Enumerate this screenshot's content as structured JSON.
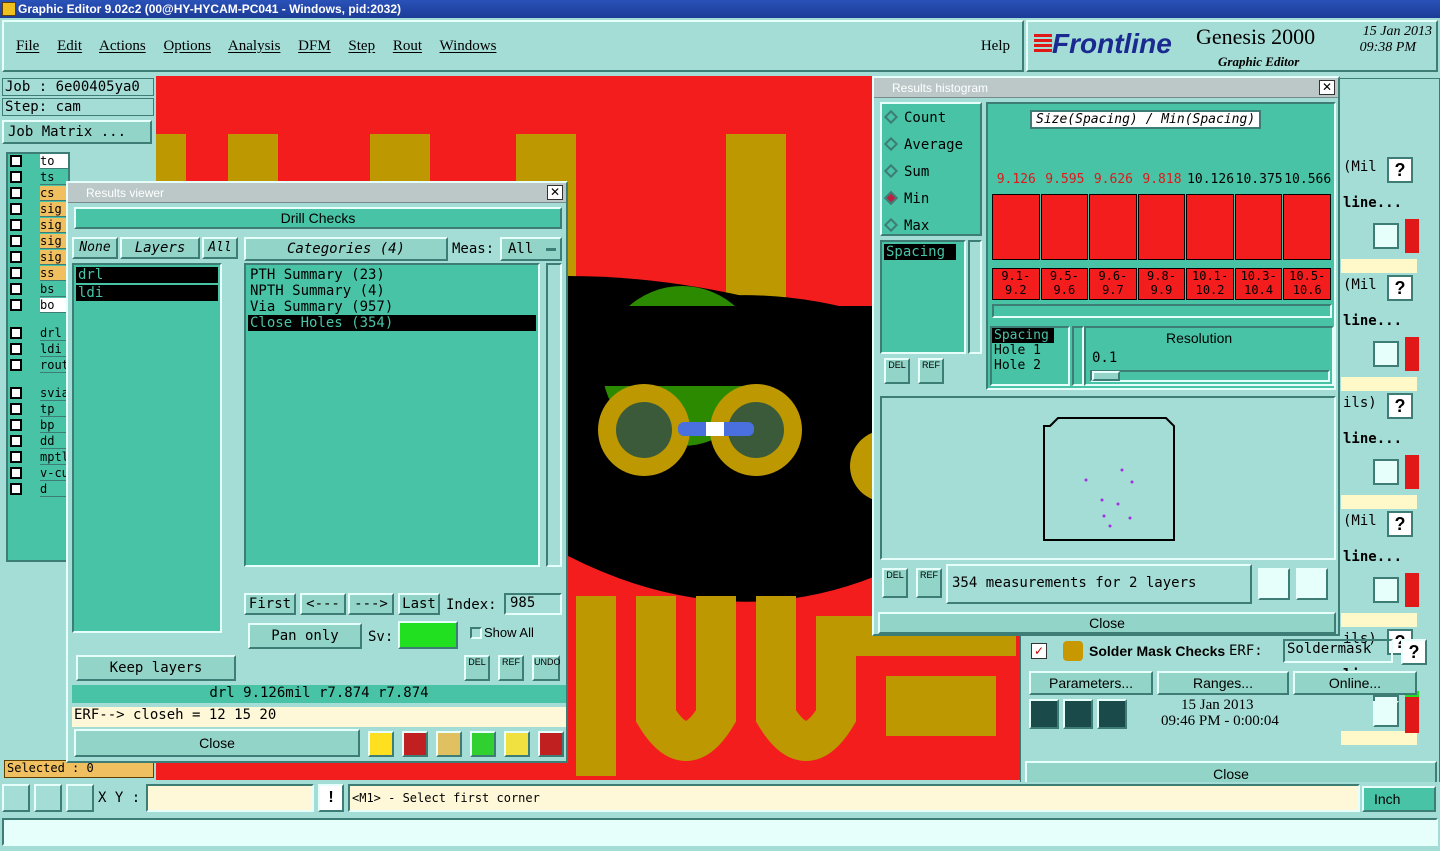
{
  "window_title": "Graphic Editor 9.02c2 (00@HY-HYCAM-PC041 - Windows, pid:2032)",
  "menu": [
    "File",
    "Edit",
    "Actions",
    "Options",
    "Analysis",
    "DFM",
    "Step",
    "Rout",
    "Windows"
  ],
  "help": "Help",
  "brand": {
    "logo": "Frontline",
    "product": "Genesis 2000",
    "subtitle": "Graphic Editor",
    "date": "15 Jan 2013",
    "time": "09:38 PM"
  },
  "left": {
    "job": "Job : 6e00405ya0",
    "step": "Step: cam",
    "job_matrix": "Job Matrix ...",
    "selected": "Selected : 0",
    "layers": [
      {
        "name": "to",
        "bg": "#ffffff"
      },
      {
        "name": "ts",
        "bg": "#49c3a6"
      },
      {
        "name": "cs",
        "bg": "#f0c060"
      },
      {
        "name": "sig",
        "bg": "#f0c060"
      },
      {
        "name": "sig",
        "bg": "#f0c060"
      },
      {
        "name": "sig",
        "bg": "#f0c060"
      },
      {
        "name": "sig",
        "bg": "#f0c060"
      },
      {
        "name": "ss",
        "bg": "#f0c060"
      },
      {
        "name": "bs",
        "bg": "#49c3a6"
      },
      {
        "name": "bo",
        "bg": "#ffffff"
      },
      {
        "name": "drl",
        "bg": "#49c3a6"
      },
      {
        "name": "ldi",
        "bg": "#49c3a6"
      },
      {
        "name": "rout",
        "bg": "#49c3a6"
      },
      {
        "name": "svia",
        "bg": "#49c3a6"
      },
      {
        "name": "tp",
        "bg": "#49c3a6"
      },
      {
        "name": "bp",
        "bg": "#49c3a6"
      },
      {
        "name": "dd",
        "bg": "#49c3a6"
      },
      {
        "name": "mptl",
        "bg": "#49c3a6"
      },
      {
        "name": "v-cu",
        "bg": "#49c3a6"
      },
      {
        "name": "d",
        "bg": "#49c3a6"
      }
    ]
  },
  "viewer": {
    "title": "Results viewer",
    "header": "Drill Checks",
    "none": "None",
    "layers": "Layers",
    "all": "All",
    "layer_items": [
      "drl",
      "ldi"
    ],
    "categories_label": "Categories (4)",
    "meas_label": "Meas:",
    "meas_value": "All",
    "categories": [
      "PTH Summary (23)",
      "NPTH Summary (4)",
      "Via Summary (957)",
      "Close Holes (354)"
    ],
    "first": "First",
    "prev": "<---",
    "next": "--->",
    "last": "Last",
    "index_label": "Index:",
    "index_value": "985",
    "keep_layers": "Keep layers",
    "pan_only": "Pan only",
    "sv": "Sv:",
    "show_all": "Show All",
    "del": "DEL",
    "ref": "REF",
    "undo": "UNDO",
    "status": "drl 9.126mil   r7.874   r7.874",
    "erf": "ERF--> closeh = 12 15 20",
    "close": "Close"
  },
  "histogram": {
    "title": "Results histogram",
    "modes": [
      "Count",
      "Average",
      "Sum",
      "Min",
      "Max"
    ],
    "selected_mode": "Min",
    "chart_title": "Size(Spacing) / Min(Spacing)",
    "list_item": "Spacing",
    "resolution_label": "Resolution",
    "resolution_value": "0.1",
    "hole_list": [
      "Spacing",
      "Hole 1",
      "Hole 2"
    ],
    "summary": "354 measurements for 2 layers",
    "close": "Close",
    "del": "DEL",
    "ref": "REF"
  },
  "chart_data": {
    "type": "bar",
    "title": "Size(Spacing) / Min(Spacing)",
    "categories": [
      "9.1-9.2",
      "9.5-9.6",
      "9.6-9.7",
      "9.8-9.9",
      "10.1-10.2",
      "10.3-10.4",
      "10.5-10.6"
    ],
    "values": [
      9.126,
      9.595,
      9.626,
      9.818,
      10.126,
      10.375,
      10.566
    ],
    "value_labels": [
      "9.126",
      "9.595",
      "9.626",
      "9.818",
      "10.126",
      "10.375",
      "10.566"
    ],
    "cat_top": [
      "9.1-",
      "9.5-",
      "9.6-",
      "9.8-",
      "10.1-",
      "10.3-",
      "10.5-"
    ],
    "cat_bottom": [
      "9.2",
      "9.6",
      "9.7",
      "9.9",
      "10.2",
      "10.4",
      "10.6"
    ]
  },
  "right_panel": {
    "items": [
      "(Mil",
      "line...",
      "(Mil",
      "line...",
      "ils)",
      "line...",
      "(Mil",
      "line...",
      "ils)",
      "line..."
    ],
    "solder_mask": "Solder Mask Checks",
    "erf": "ERF:",
    "erf_value": "Soldermask",
    "parameters": "Parameters...",
    "ranges": "Ranges...",
    "online": "Online...",
    "date": "15 Jan 2013",
    "time": "09:46 PM - 0:00:04",
    "close": "Close"
  },
  "bottom": {
    "xy": "X Y :",
    "message": "<M1> - Select first corner",
    "unit": "Inch"
  },
  "colors": {
    "bg": "#a4dcd6",
    "pcb_red": "#f41d1d",
    "copper": "#bd9800",
    "mask_green": "#2c8a00",
    "panel": "#49c3a6"
  }
}
